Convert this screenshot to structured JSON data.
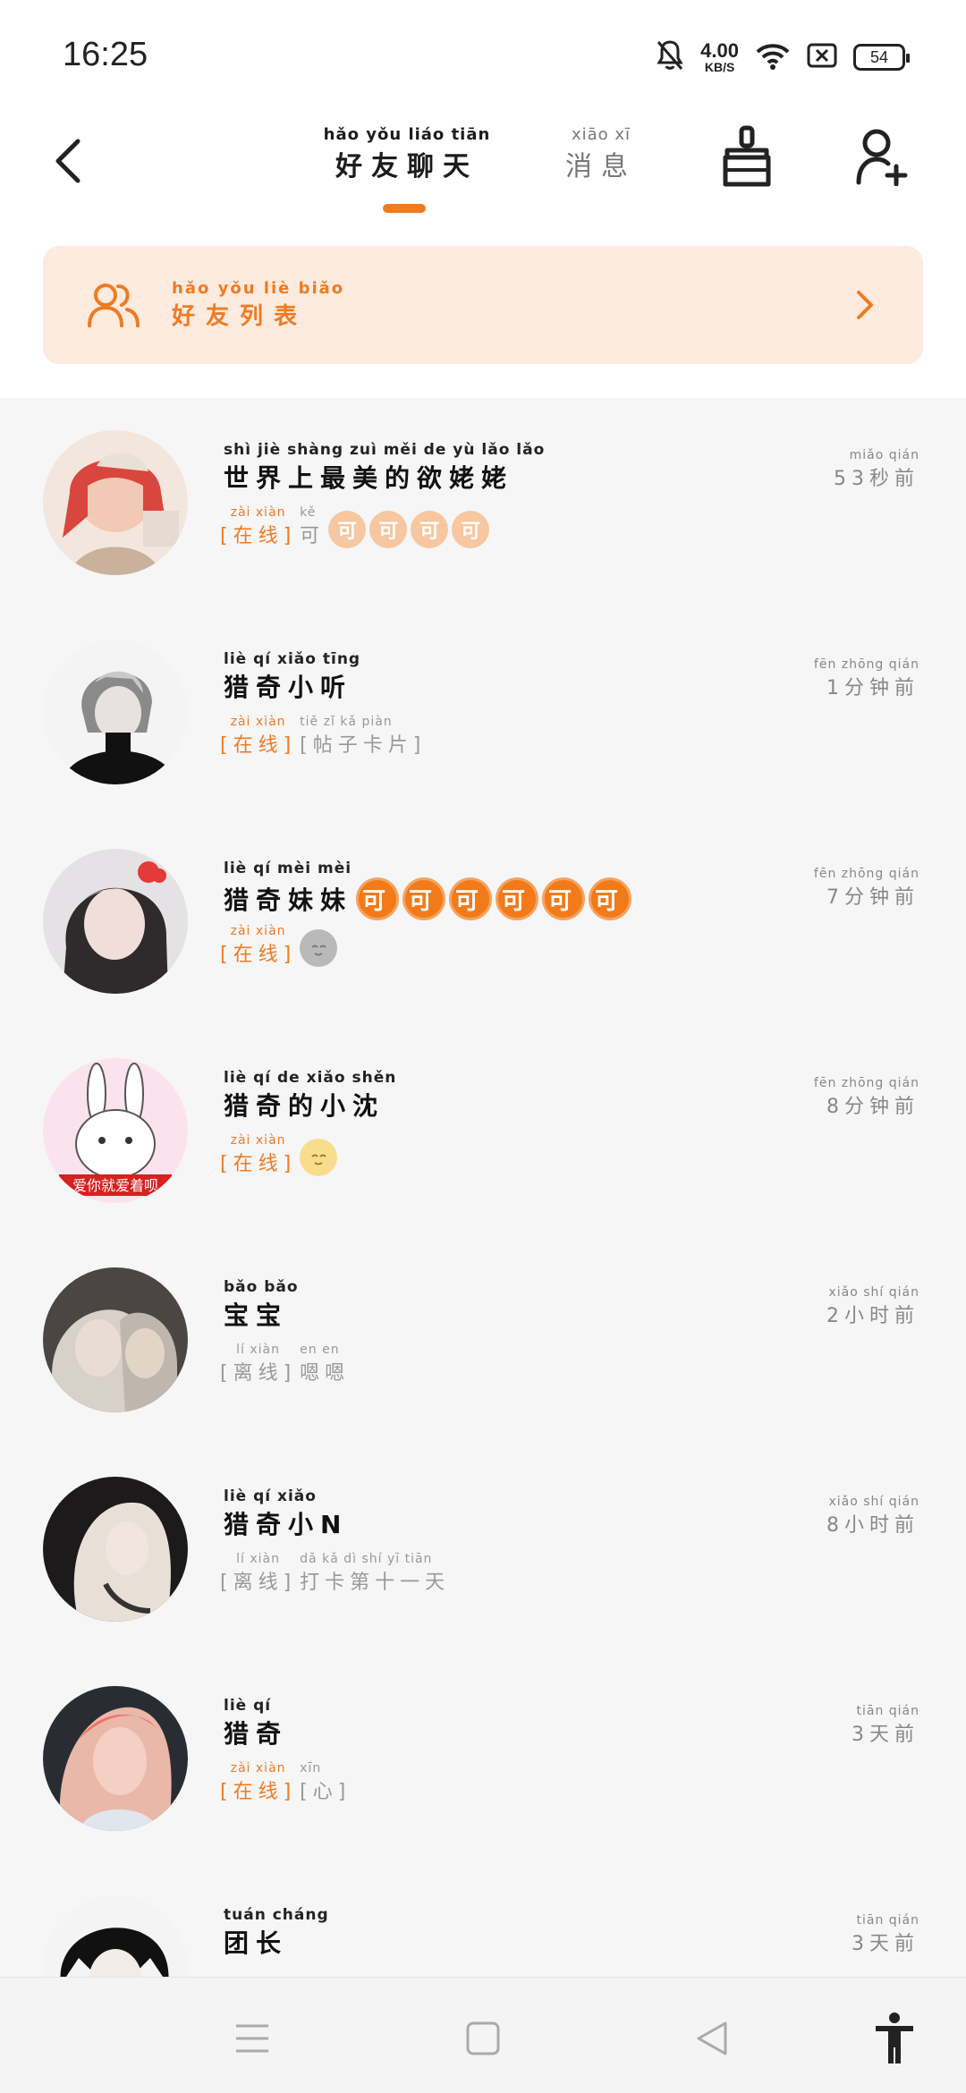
{
  "status_bar": {
    "time": "16:25",
    "speed_value": "4.00",
    "speed_unit": "KB/S",
    "battery": "54",
    "icons": [
      "bell-off-icon",
      "wifi-icon",
      "sim-disabled-icon",
      "battery-icon"
    ]
  },
  "header": {
    "tabs": [
      {
        "pinyin": "hǎo yǒu liáo tiān",
        "label": "好友聊天",
        "active": true
      },
      {
        "pinyin": "xiāo xī",
        "label": "消息",
        "active": false
      }
    ],
    "accent_color": "#f07b21"
  },
  "banner": {
    "pinyin": "hǎo yǒu liè biǎo",
    "label": "好友列表"
  },
  "friends": [
    {
      "name_pinyin": "shì jiè shàng zuì měi de yù lǎo lǎo",
      "name": "世界上最美的欲姥姥",
      "status_pinyin": "zài xiàn",
      "status": "[在线]",
      "online": true,
      "desc_pinyin": "kě",
      "desc": "可",
      "badges": [
        "可",
        "可",
        "可",
        "可"
      ],
      "time_pinyin": "miǎo qián",
      "time": "53秒前"
    },
    {
      "name_pinyin": "liè qí xiǎo tīng",
      "name": "猎奇小听",
      "status_pinyin": "zài xiàn",
      "status": "[在线]",
      "online": true,
      "desc_pinyin": "tiě zǐ kǎ piàn",
      "desc": "[帖子卡片]",
      "time_pinyin": "fēn zhōng qián",
      "time": "1分钟前"
    },
    {
      "name_pinyin": "liè qí mèi mèi",
      "name": "猎奇妹妹",
      "name_badges": [
        "可",
        "可",
        "可",
        "可",
        "可",
        "可"
      ],
      "status_pinyin": "zài xiàn",
      "status": "[在线]",
      "online": true,
      "emoji": "grey-moon-emoji",
      "time_pinyin": "fēn zhōng qián",
      "time": "7分钟前"
    },
    {
      "name_pinyin": "liè qí de xiǎo shěn",
      "name": "猎奇的小沈",
      "status_pinyin": "zài xiàn",
      "status": "[在线]",
      "online": true,
      "emoji": "yellow-moon-emoji",
      "avatar_caption": "爱你就爱着呗",
      "time_pinyin": "fēn zhōng qián",
      "time": "8分钟前"
    },
    {
      "name_pinyin": "bǎo bǎo",
      "name": "宝宝",
      "status_pinyin": "lí xiàn",
      "status": "[离线]",
      "online": false,
      "desc_pinyin": "en en",
      "desc": "嗯嗯",
      "time_pinyin": "xiǎo shí qián",
      "time": "2小时前"
    },
    {
      "name_pinyin": "liè qí xiǎo",
      "name": "猎奇小N",
      "status_pinyin": "lí xiàn",
      "status": "[离线]",
      "online": false,
      "desc_pinyin": "dǎ kǎ dì shí yī tiān",
      "desc": "打卡第十一天",
      "time_pinyin": "xiǎo shí qián",
      "time": "8小时前"
    },
    {
      "name_pinyin": "liè qí",
      "name": "猎奇",
      "status_pinyin": "zài xiàn",
      "status": "[在线]",
      "online": true,
      "desc_pinyin": "xīn",
      "desc": "[心]",
      "time_pinyin": "tiān qián",
      "time": "3天前"
    },
    {
      "name_pinyin": "tuán cháng",
      "name": "团长",
      "time_pinyin": "tiān qián",
      "time": "3天前"
    }
  ],
  "nav_bar": {
    "icons": [
      "menu-icon",
      "home-square-icon",
      "back-triangle-icon",
      "accessibility-icon"
    ]
  }
}
